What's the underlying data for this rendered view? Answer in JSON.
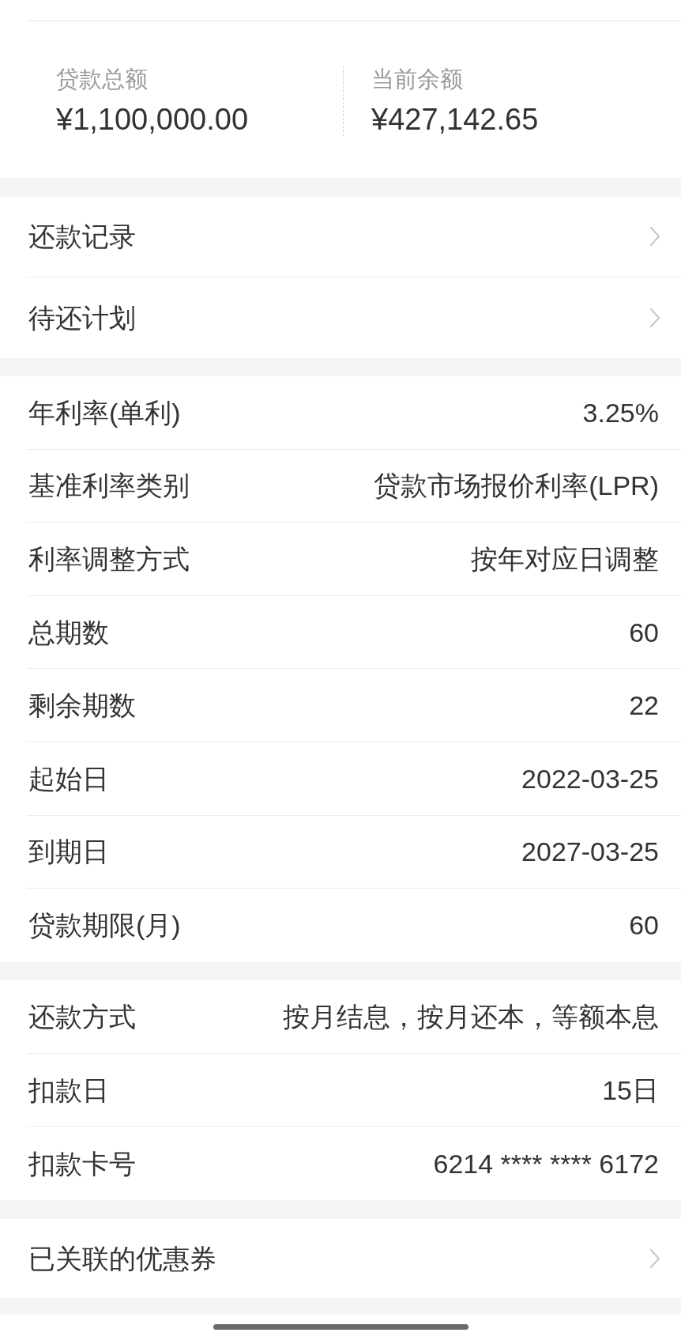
{
  "summary": [
    {
      "label": "贷款总额",
      "value": "¥1,100,000.00"
    },
    {
      "label": "当前余额",
      "value": "¥427,142.65"
    }
  ],
  "sections": [
    {
      "rows": [
        {
          "kind": "link",
          "label": "还款记录"
        },
        {
          "kind": "link",
          "label": "待还计划"
        }
      ]
    },
    {
      "rows": [
        {
          "kind": "detail",
          "label": "年利率(单利)",
          "value": "3.25%"
        },
        {
          "kind": "detail",
          "label": "基准利率类别",
          "value": "贷款市场报价利率(LPR)"
        },
        {
          "kind": "detail",
          "label": "利率调整方式",
          "value": "按年对应日调整"
        },
        {
          "kind": "detail",
          "label": "总期数",
          "value": "60"
        },
        {
          "kind": "detail",
          "label": "剩余期数",
          "value": "22"
        },
        {
          "kind": "detail",
          "label": "起始日",
          "value": "2022-03-25"
        },
        {
          "kind": "detail",
          "label": "到期日",
          "value": "2027-03-25"
        },
        {
          "kind": "detail",
          "label": "贷款期限(月)",
          "value": "60"
        }
      ]
    },
    {
      "rows": [
        {
          "kind": "detail",
          "label": "还款方式",
          "value": "按月结息，按月还本，等额本息"
        },
        {
          "kind": "detail",
          "label": "扣款日",
          "value": "15日"
        },
        {
          "kind": "detail",
          "label": "扣款卡号",
          "value": "6214 **** **** 6172"
        }
      ]
    },
    {
      "rows": [
        {
          "kind": "link",
          "label": "已关联的优惠券"
        }
      ]
    }
  ]
}
